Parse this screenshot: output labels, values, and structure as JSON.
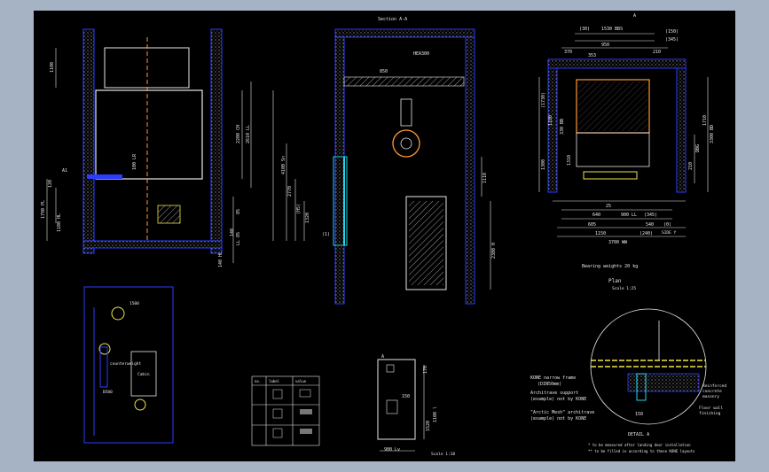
{
  "colors": {
    "background_outer": "#a6b3c4",
    "background_canvas": "#000000",
    "border_frame": "#2b3cff",
    "lines_white": "#e8e8e8",
    "lines_cyan": "#21d6e8",
    "lines_yellow": "#f1e24a",
    "lines_orange": "#ff9a2e",
    "hatch": "#8a8a8a"
  },
  "section": {
    "title": "Section A-A",
    "beam_label": "HEA300",
    "dim_850": "850",
    "dims_left": [
      "4100 Sn",
      "2770",
      "(H5)",
      "1320"
    ],
    "dims_right": [
      "1110",
      "2300 H"
    ],
    "label_small": "(1)"
  },
  "left_view": {
    "dims_left": [
      "1100",
      "120",
      "1790 PL",
      "1100 HL"
    ],
    "dims_right": [
      "2200 CH",
      "2610 LL",
      "85",
      "140",
      "LL 85",
      "140 HL"
    ],
    "label_a": "A1",
    "label_b": "100 LR"
  },
  "plan": {
    "title": "Plan",
    "scale": "Scale 1:25",
    "top_dims": [
      "(30)",
      "1530 BBS",
      "(150)",
      "(345)",
      "370",
      "950",
      "210",
      "353"
    ],
    "right_dims": [
      "1710",
      "210",
      "DBG",
      "3300 BD"
    ],
    "left_dims": [
      "(1730)",
      "1180",
      "330 BB",
      "1310",
      "1300"
    ],
    "bottom_dims": [
      "25",
      "900 LL",
      "(345)",
      "640",
      "540",
      "(0)",
      "605",
      "1150",
      "(240)",
      "3700 WW"
    ],
    "label_a": "A",
    "label_bearing": "Bearing weights 20 kg",
    "label_side": "SIDE Y"
  },
  "detail": {
    "title": "DETAIL A",
    "label1": "KONE narrow frame",
    "label1b": "(DIN50mm)",
    "label2": "Architrave support",
    "label2b": "(example) not by KONE",
    "label3": "\"Arctic Mesh\" architrave",
    "label3b": "(example) not by KONE",
    "label4": "Reinforced",
    "label4b": "concrete",
    "label4c": "masonry",
    "label5": "Floor wall",
    "label5b": "finishing",
    "dim_150": "150",
    "note1": "* to be measured after landing door installation",
    "note2": "** to be filled in according to these KONE layouts"
  },
  "panel": {
    "label_top": "A",
    "dims": [
      "170",
      "150",
      "1520",
      "1100 l"
    ],
    "bottom_dim": "900 Lv",
    "scale": "Scale 1:10"
  },
  "table": {
    "headers": [
      "no.",
      "label",
      "value"
    ],
    "rows": [
      [
        "1",
        "",
        ""
      ],
      [
        "2",
        "",
        ""
      ],
      [
        "3",
        "",
        ""
      ]
    ]
  },
  "car_panel": {
    "label_1": "1500",
    "label_2": "B500",
    "label_3": "counterweight",
    "label_4": "Cabin"
  }
}
